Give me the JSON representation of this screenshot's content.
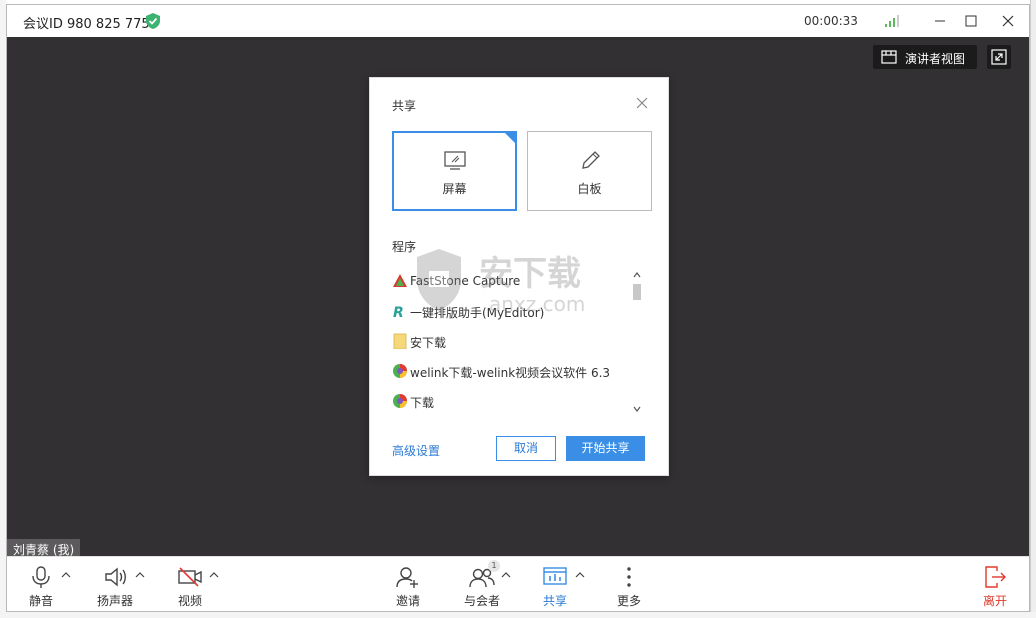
{
  "titlebar": {
    "meeting_id": "会议ID 980 825 775",
    "timer": "00:00:33"
  },
  "stage": {
    "presenter_view_label": "演讲者视图",
    "self_name_tag": "刘青蔡 (我)"
  },
  "share_dialog": {
    "title": "共享",
    "options": [
      {
        "label": "屏幕",
        "icon": "screen-icon",
        "selected": true
      },
      {
        "label": "白板",
        "icon": "pen-icon",
        "selected": false
      }
    ],
    "programs_label": "程序",
    "programs": [
      {
        "label": "FastStone Capture",
        "icon": "faststone-icon"
      },
      {
        "label": "一键排版助手(MyEditor)",
        "icon": "myeditor-icon"
      },
      {
        "label": "安下载",
        "icon": "folder-icon"
      },
      {
        "label": "welink下载-welink视频会议软件 6.3",
        "icon": "browser-icon"
      },
      {
        "label": "下载",
        "icon": "browser-icon"
      }
    ],
    "advanced_settings": "高级设置",
    "cancel": "取消",
    "start_share": "开始共享"
  },
  "watermark": {
    "text_cn": "安下载",
    "text_en": "anxz.com"
  },
  "toolbar": {
    "mute": "静音",
    "speaker": "扬声器",
    "video": "视频",
    "invite": "邀请",
    "participants": "与会者",
    "participants_count": "1",
    "share": "共享",
    "more": "更多",
    "leave": "离开"
  },
  "colors": {
    "accent": "#3a8ee6",
    "stage_bg": "#333033",
    "leave": "#e0392b",
    "secure": "#3cb371"
  }
}
